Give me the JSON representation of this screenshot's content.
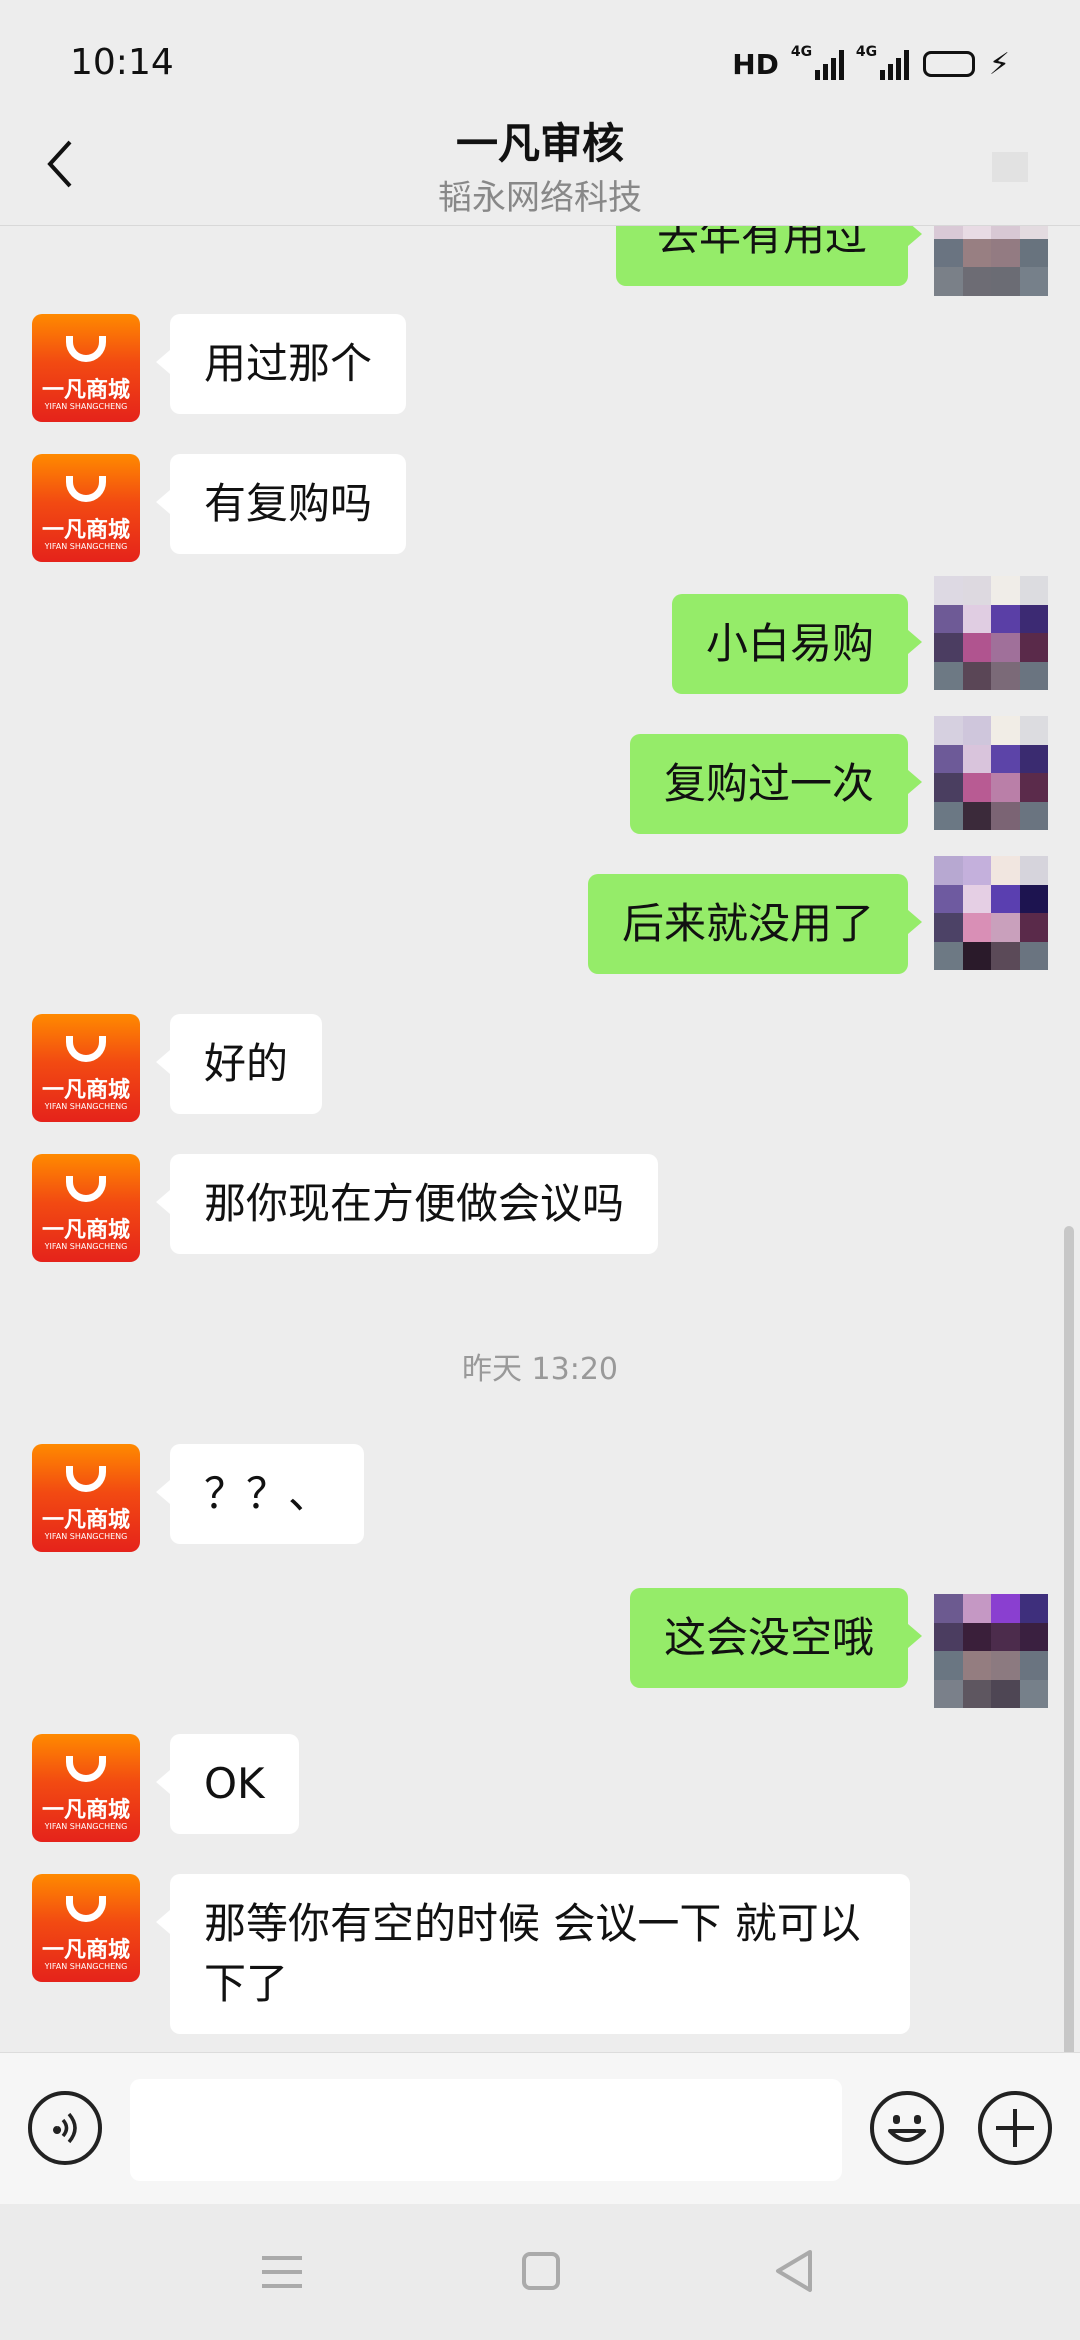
{
  "status_bar": {
    "time": "10:14",
    "hd_label": "HD",
    "sim1_label": "4G",
    "sim2_label": "4G",
    "battery_level": 0.45,
    "charging_icon": "bolt-icon"
  },
  "header": {
    "title": "一凡审核",
    "subtitle": "韬永网络科技",
    "back_icon": "chevron-left-icon"
  },
  "shop_avatar": {
    "brand": "一凡商城",
    "brand_en": "YIFAN SHANGCHENG"
  },
  "messages": [
    {
      "side": "out",
      "text": "去年有用过"
    },
    {
      "side": "in",
      "text": "用过那个"
    },
    {
      "side": "in",
      "text": "有复购吗"
    },
    {
      "side": "out",
      "text": "小白易购"
    },
    {
      "side": "out",
      "text": "复购过一次"
    },
    {
      "side": "out",
      "text": "后来就没用了"
    },
    {
      "side": "in",
      "text": "好的"
    },
    {
      "side": "in",
      "text": "那你现在方便做会议吗"
    },
    {
      "side": "in",
      "text": "？？、"
    },
    {
      "side": "out",
      "text": "这会没空哦"
    },
    {
      "side": "in",
      "text": "OK"
    },
    {
      "side": "in",
      "text": "那等你有空的时候 会议一下 就可以下了"
    }
  ],
  "timestamp": "昨天 13:20",
  "input_bar": {
    "placeholder": "",
    "voice_icon": "voice-icon",
    "emoji_icon": "emoji-icon",
    "plus_icon": "plus-icon"
  },
  "colors": {
    "outgoing_bubble": "#95ec69",
    "incoming_bubble": "#ffffff",
    "background": "#ededed"
  }
}
